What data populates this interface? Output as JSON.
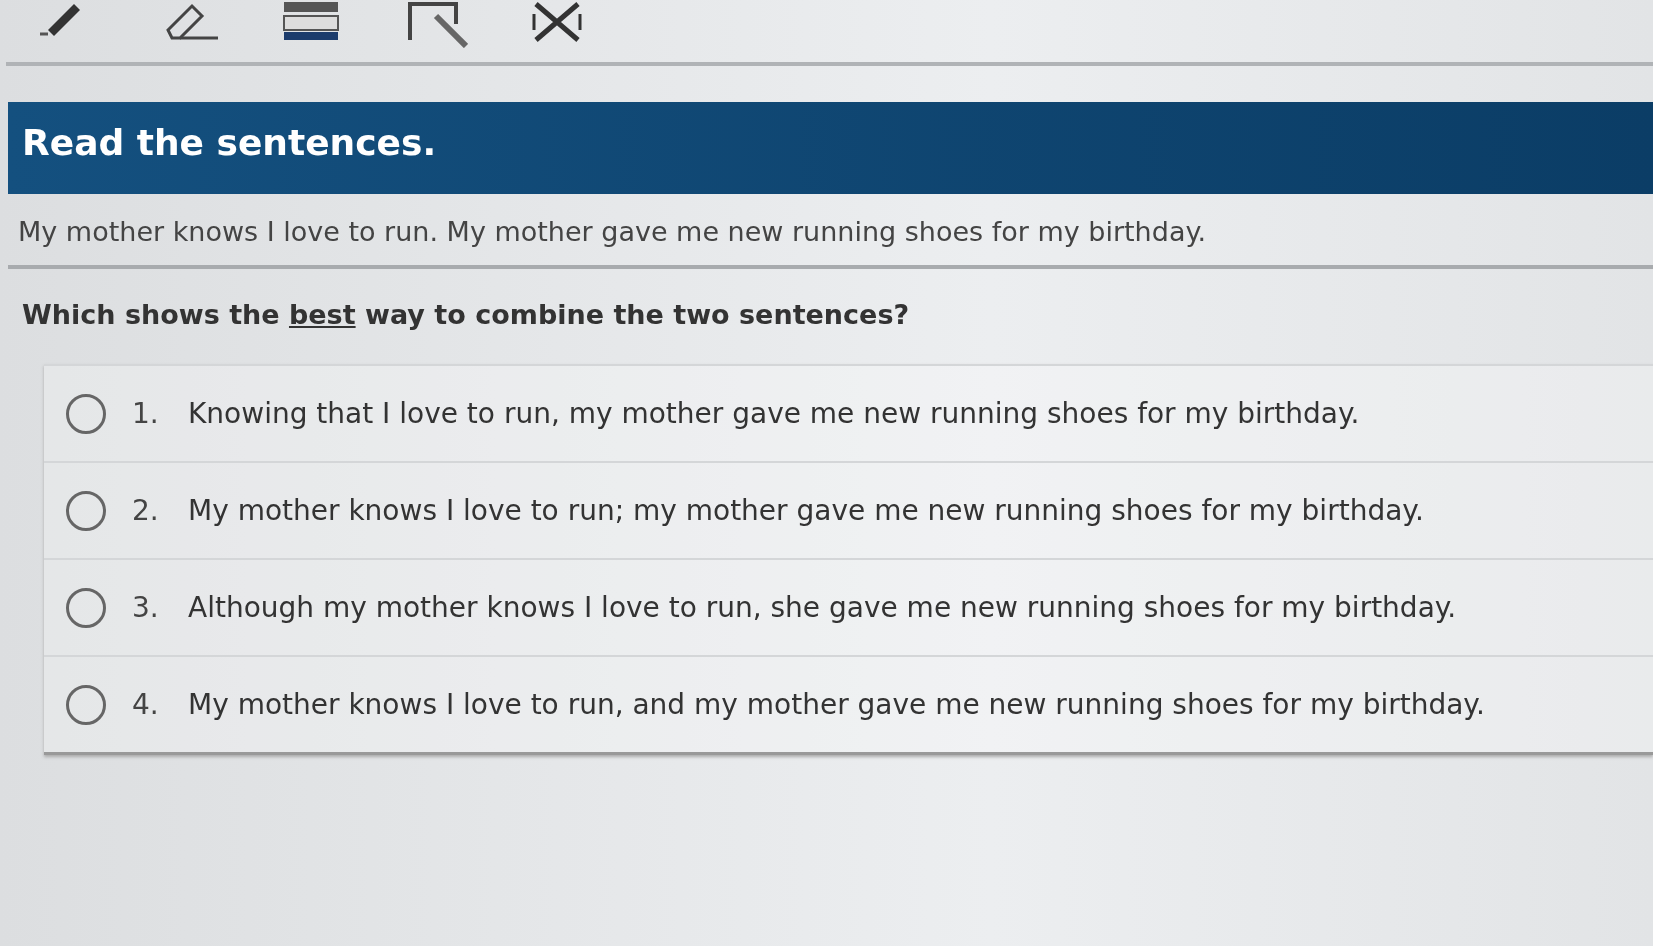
{
  "toolbar": {
    "tools": [
      {
        "kind": "pencil"
      },
      {
        "kind": "eraser"
      },
      {
        "kind": "highlighter"
      },
      {
        "kind": "notepad"
      },
      {
        "kind": "eliminate"
      }
    ]
  },
  "header": {
    "title": "Read the sentences."
  },
  "passage": "My mother knows I love to run. My mother gave me new running shoes for my birthday.",
  "question": {
    "parts": [
      {
        "text": "Which shows the ",
        "underline": false
      },
      {
        "text": "best",
        "underline": true
      },
      {
        "text": " way to combine the two sentences?",
        "underline": false
      }
    ]
  },
  "options": [
    {
      "number": "1.",
      "text": "Knowing that I love to run, my mother gave me new running shoes for my birthday.",
      "selected": false
    },
    {
      "number": "2.",
      "text": "My mother knows I love to run; my mother gave me new running shoes for my birthday.",
      "selected": false
    },
    {
      "number": "3.",
      "text": "Although my mother knows I love to run, she gave me new running shoes for my birthday.",
      "selected": false
    },
    {
      "number": "4.",
      "text": "My mother knows I love to run, and my mother gave me new running shoes for my birthday.",
      "selected": false
    }
  ]
}
